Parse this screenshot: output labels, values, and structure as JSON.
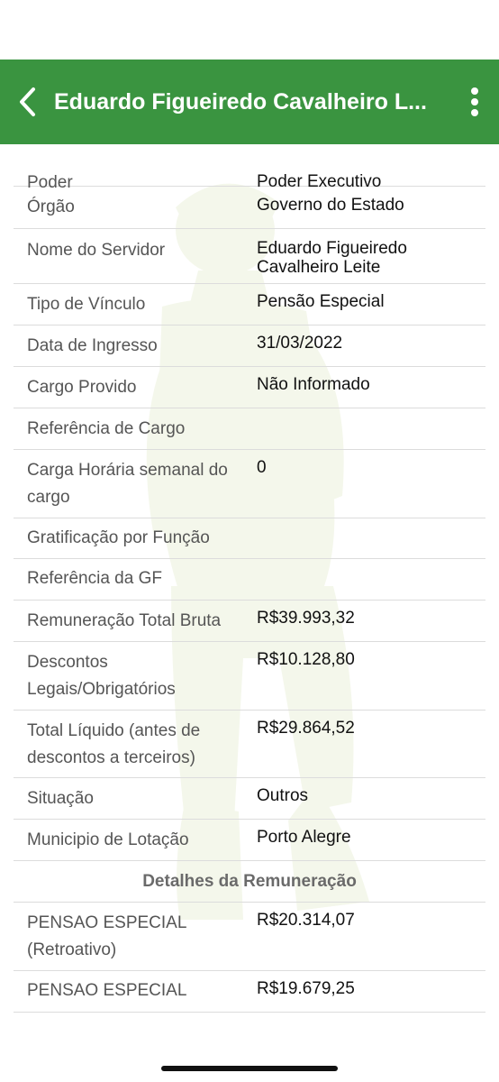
{
  "header": {
    "title": "Eduardo Figueiredo Cavalheiro L...",
    "back_icon": "chevron-left-icon",
    "menu_icon": "more-vertical-icon",
    "color": "#3a9440"
  },
  "rows": [
    {
      "label": "Poder",
      "value": "Poder Executivo"
    },
    {
      "label": "Órgão",
      "value": "Governo do Estado"
    },
    {
      "label": "Nome do Servidor",
      "value": "Eduardo Figueiredo Cavalheiro Leite"
    },
    {
      "label": "Tipo de Vínculo",
      "value": "Pensão Especial"
    },
    {
      "label": "Data de Ingresso",
      "value": "31/03/2022"
    },
    {
      "label": "Cargo Provido",
      "value": "Não Informado"
    },
    {
      "label": "Referência de Cargo",
      "value": ""
    },
    {
      "label": "Carga Horária semanal do cargo",
      "value": "0"
    },
    {
      "label": "Gratificação por Função",
      "value": ""
    },
    {
      "label": "Referência da GF",
      "value": ""
    },
    {
      "label": "Remuneração Total Bruta",
      "value": "R$39.993,32"
    },
    {
      "label": "Descontos Legais/Obrigatórios",
      "value": "R$10.128,80"
    },
    {
      "label": "Total Líquido (antes de descontos a terceiros)",
      "value": "R$29.864,52"
    },
    {
      "label": "Situação",
      "value": "Outros"
    },
    {
      "label": "Municipio de Lotação",
      "value": "Porto Alegre"
    }
  ],
  "section_title": "Detalhes da Remuneração",
  "details": [
    {
      "label": "PENSAO ESPECIAL (Retroativo)",
      "value": "R$20.314,07"
    },
    {
      "label": "PENSAO ESPECIAL",
      "value": "R$19.679,25"
    }
  ]
}
